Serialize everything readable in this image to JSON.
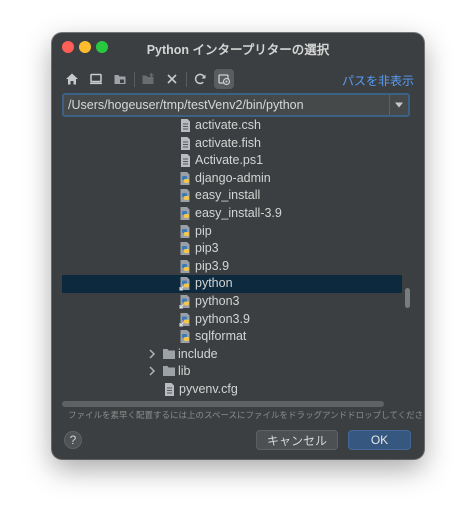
{
  "window": {
    "title": "Python インタープリターの選択"
  },
  "toolbar": {
    "icons": [
      "home-icon",
      "desktop-icon",
      "project-folder-icon",
      "new-folder-icon",
      "delete-icon",
      "refresh-icon",
      "show-hidden-icon"
    ],
    "hide_path_label": "パスを非表示"
  },
  "path": {
    "value": "/Users/hogeuser/tmp/testVenv2/bin/python"
  },
  "tree": {
    "items": [
      {
        "label": "activate.csh",
        "type": "text-file",
        "depth": 2
      },
      {
        "label": "activate.fish",
        "type": "text-file",
        "depth": 2
      },
      {
        "label": "Activate.ps1",
        "type": "text-file",
        "depth": 2
      },
      {
        "label": "django-admin",
        "type": "python-file",
        "depth": 2
      },
      {
        "label": "easy_install",
        "type": "python-file",
        "depth": 2
      },
      {
        "label": "easy_install-3.9",
        "type": "python-file",
        "depth": 2
      },
      {
        "label": "pip",
        "type": "python-file",
        "depth": 2
      },
      {
        "label": "pip3",
        "type": "python-file",
        "depth": 2
      },
      {
        "label": "pip3.9",
        "type": "python-file",
        "depth": 2
      },
      {
        "label": "python",
        "type": "python-link",
        "depth": 2,
        "selected": true
      },
      {
        "label": "python3",
        "type": "python-link",
        "depth": 2
      },
      {
        "label": "python3.9",
        "type": "python-link",
        "depth": 2
      },
      {
        "label": "sqlformat",
        "type": "python-file",
        "depth": 2
      },
      {
        "label": "include",
        "type": "folder",
        "depth": 1
      },
      {
        "label": "lib",
        "type": "folder",
        "depth": 1
      },
      {
        "label": "pyvenv.cfg",
        "type": "text-file",
        "depth": 1
      }
    ]
  },
  "hint": "ファイルを素早く配置するには上のスペースにファイルをドラッグアンドドロップしてください",
  "buttons": {
    "help": "?",
    "cancel": "キャンセル",
    "ok": "OK"
  },
  "colors": {
    "background": "#3c3f41",
    "accent": "#589df6",
    "selection": "#0d293e",
    "ok_button": "#365880"
  }
}
